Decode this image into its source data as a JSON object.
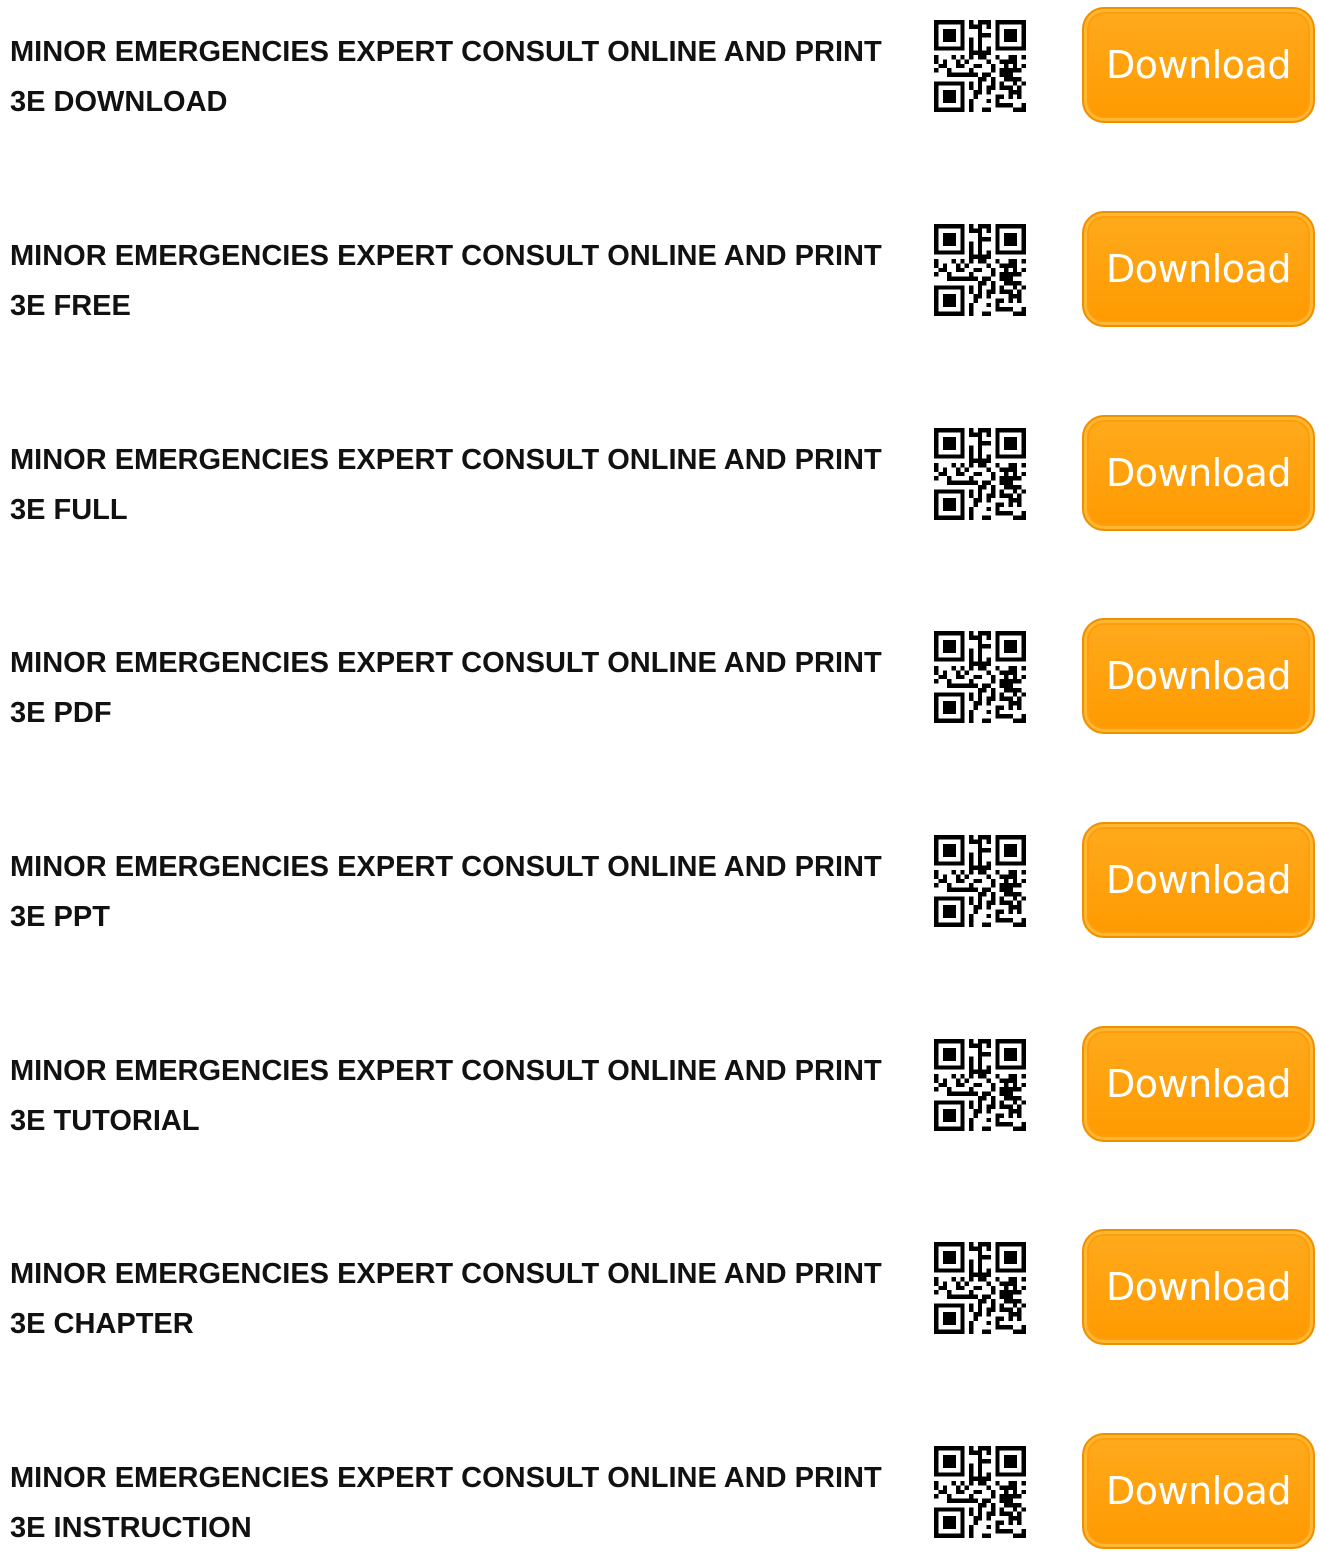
{
  "items": [
    {
      "title": "MINOR EMERGENCIES EXPERT CONSULT ONLINE AND PRINT 3E DOWNLOAD",
      "button_label": "Download"
    },
    {
      "title": "MINOR EMERGENCIES EXPERT CONSULT ONLINE AND PRINT 3E FREE",
      "button_label": "Download"
    },
    {
      "title": "MINOR EMERGENCIES EXPERT CONSULT ONLINE AND PRINT 3E FULL",
      "button_label": "Download"
    },
    {
      "title": "MINOR EMERGENCIES EXPERT CONSULT ONLINE AND PRINT 3E PDF",
      "button_label": "Download"
    },
    {
      "title": "MINOR EMERGENCIES EXPERT CONSULT ONLINE AND PRINT 3E PPT",
      "button_label": "Download"
    },
    {
      "title": "MINOR EMERGENCIES EXPERT CONSULT ONLINE AND PRINT 3E TUTORIAL",
      "button_label": "Download"
    },
    {
      "title": "MINOR EMERGENCIES EXPERT CONSULT ONLINE AND PRINT 3E CHAPTER",
      "button_label": "Download"
    },
    {
      "title": "MINOR EMERGENCIES EXPERT CONSULT ONLINE AND PRINT 3E INSTRUCTION",
      "button_label": "Download"
    }
  ],
  "colors": {
    "button_background": "#ff9f0a",
    "button_text": "#ffffff",
    "title_text": "#111111"
  },
  "icons": {
    "qr": "qr-code-icon"
  }
}
